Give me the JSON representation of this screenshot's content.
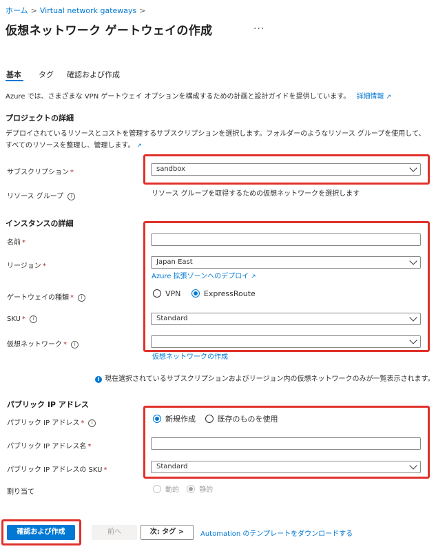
{
  "breadcrumb": {
    "home": "ホーム",
    "parent": "Virtual network gateways",
    "sep": ">"
  },
  "page_title": "仮想ネットワーク ゲートウェイの作成",
  "more_label": "···",
  "tabs": [
    {
      "label": "基本"
    },
    {
      "label": "タグ"
    },
    {
      "label": "確認および作成"
    }
  ],
  "intro": {
    "text": "Azure では、さまざまな VPN ゲートウェイ オプションを構成するための計画と設計ガイドを提供しています。",
    "link": "詳細情報"
  },
  "project": {
    "heading": "プロジェクトの詳細",
    "description": "デプロイされているリソースとコストを管理するサブスクリプションを選択します。フォルダーのようなリソース グループを使用して、すべてのリソースを整理し、管理します。",
    "subscription_label": "サブスクリプション",
    "subscription_value": "sandbox",
    "resource_group_label": "リソース グループ",
    "resource_group_text": "リソース グループを取得するための仮想ネットワークを選択します"
  },
  "instance": {
    "heading": "インスタンスの詳細",
    "name_label": "名前",
    "name_value": "",
    "region_label": "リージョン",
    "region_value": "Japan East",
    "edge_zone_link": "Azure 拡張ゾーンへのデプロイ",
    "gateway_type_label": "ゲートウェイの種類",
    "gateway_type_options": [
      "VPN",
      "ExpressRoute"
    ],
    "gateway_type_selected": "ExpressRoute",
    "sku_label": "SKU",
    "sku_value": "Standard",
    "vnet_label": "仮想ネットワーク",
    "vnet_value": "",
    "vnet_create_link": "仮想ネットワークの作成",
    "vnet_note": "現在選択されているサブスクリプションおよびリージョン内の仮想ネットワークのみが一覧表示されます。"
  },
  "public_ip": {
    "heading": "パブリック IP アドレス",
    "address_label": "パブリック IP アドレス",
    "address_options": [
      "新規作成",
      "既存のものを使用"
    ],
    "address_selected": "新規作成",
    "name_label": "パブリック IP アドレス名",
    "name_value": "",
    "sku_label": "パブリック IP アドレスの SKU",
    "sku_value": "Standard",
    "assignment_label": "割り当て",
    "assignment_options": [
      "動的",
      "静的"
    ],
    "assignment_selected": "静的"
  },
  "footer": {
    "review_create": "確認および作成",
    "previous": "前へ",
    "next": "次: タグ >",
    "download_template": "Automation のテンプレートをダウンロードする"
  },
  "colors": {
    "accent": "#0078d4",
    "highlight": "#e0302a",
    "required": "#a4262c"
  }
}
